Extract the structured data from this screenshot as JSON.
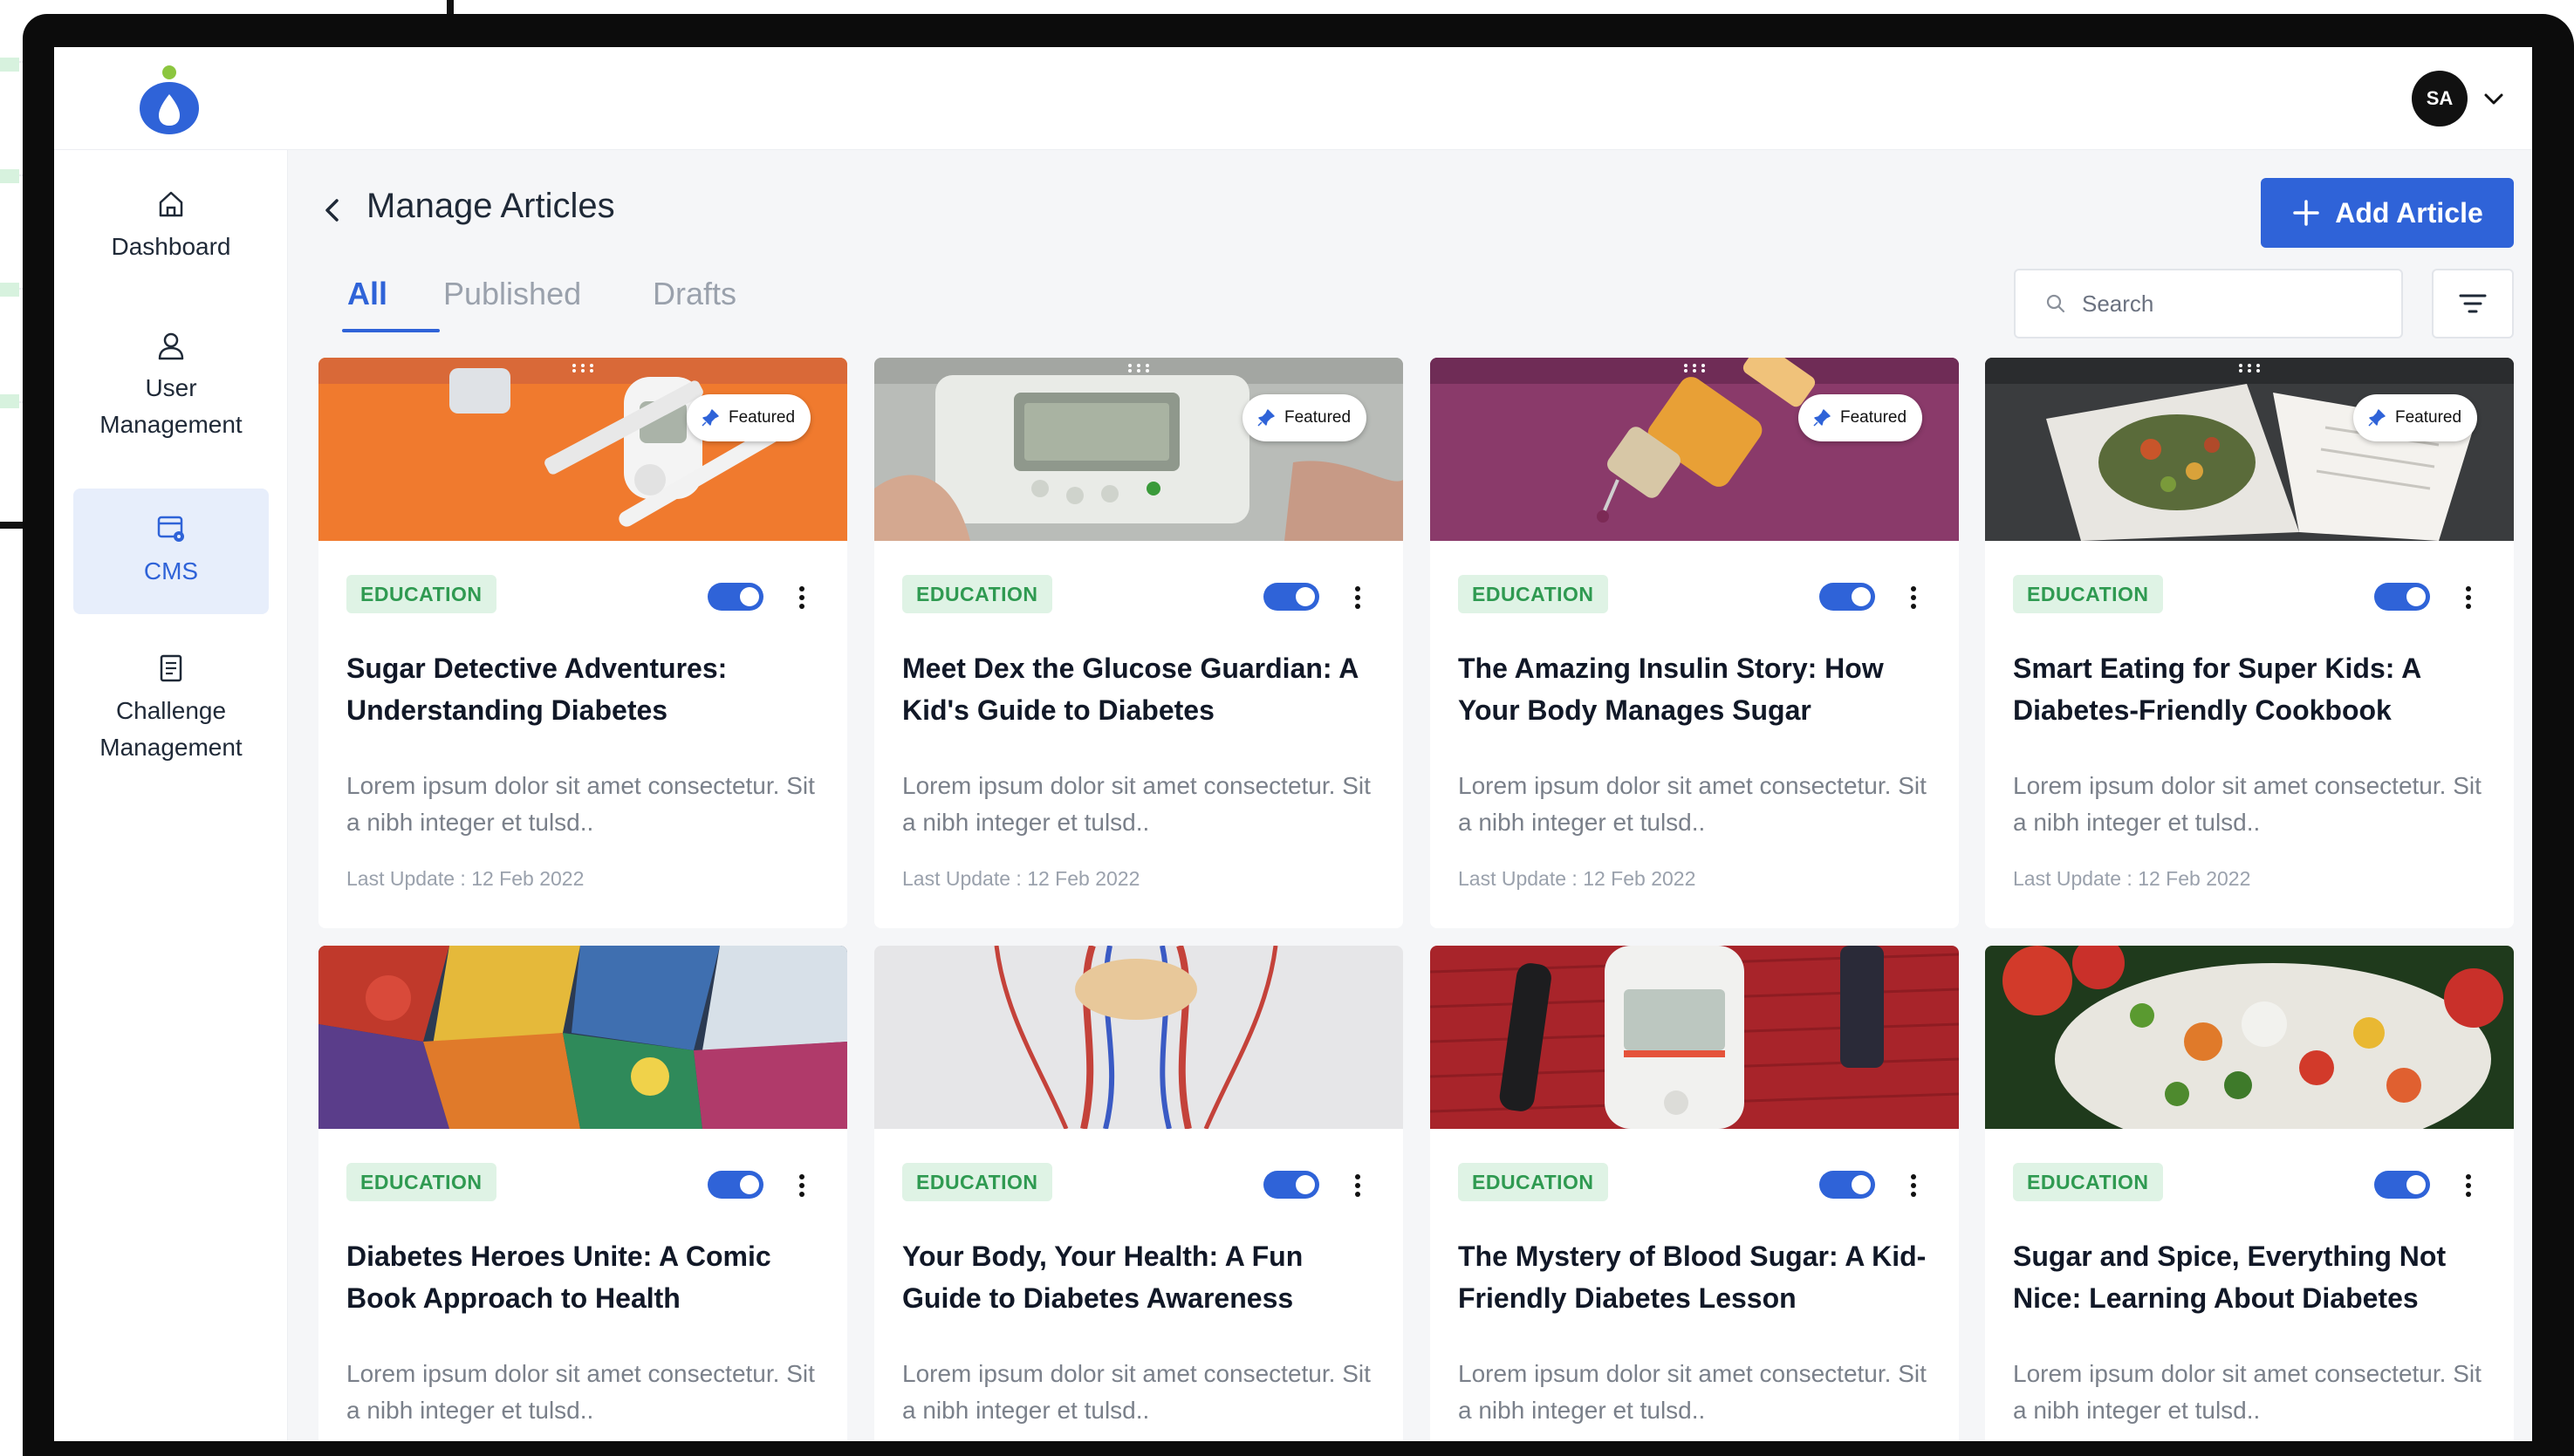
{
  "app": {
    "user_initials": "SA"
  },
  "sidebar": {
    "items": [
      {
        "label_line1": "Dashboard",
        "label_line2": "",
        "icon": "home-icon",
        "active": false
      },
      {
        "label_line1": "User",
        "label_line2": "Management",
        "icon": "user-icon",
        "active": false
      },
      {
        "label_line1": "CMS",
        "label_line2": "",
        "icon": "cms-icon",
        "active": true
      },
      {
        "label_line1": "Challenge",
        "label_line2": "Management",
        "icon": "clipboard-icon",
        "active": false
      }
    ]
  },
  "header": {
    "title": "Manage Articles",
    "add_button_label": "Add Article"
  },
  "tabs": [
    {
      "label": "All",
      "active": true
    },
    {
      "label": "Published",
      "active": false
    },
    {
      "label": "Drafts",
      "active": false
    }
  ],
  "search": {
    "placeholder": "Search"
  },
  "colors": {
    "accent": "#2f63d8",
    "tag_bg": "#dff3e5",
    "tag_text": "#2f9a51"
  },
  "articles": [
    {
      "title": "Sugar Detective Adventures: Understanding Diabetes",
      "category": "EDUCATION",
      "featured": "Featured",
      "description": "Lorem ipsum dolor sit amet consectetur. Sit a nibh integer et tulsd..",
      "last_update": "Last Update : 12 Feb 2022",
      "published": true
    },
    {
      "title": "Meet Dex the Glucose Guardian: A Kid's Guide to Diabetes",
      "category": "EDUCATION",
      "featured": "Featured",
      "description": "Lorem ipsum dolor sit amet consectetur. Sit a nibh integer et tulsd..",
      "last_update": "Last Update : 12 Feb 2022",
      "published": true
    },
    {
      "title": "The Amazing Insulin Story: How Your Body Manages Sugar",
      "category": "EDUCATION",
      "featured": "Featured",
      "description": "Lorem ipsum dolor sit amet consectetur. Sit a nibh integer et tulsd..",
      "last_update": "Last Update : 12 Feb 2022",
      "published": true
    },
    {
      "title": "Smart Eating for Super Kids: A Diabetes-Friendly Cookbook",
      "category": "EDUCATION",
      "featured": "Featured",
      "description": "Lorem ipsum dolor sit amet consectetur. Sit a nibh integer et tulsd..",
      "last_update": "Last Update : 12 Feb 2022",
      "published": true
    },
    {
      "title": "Diabetes Heroes Unite: A Comic Book Approach to Health",
      "category": "EDUCATION",
      "description": "Lorem ipsum dolor sit amet consectetur. Sit a nibh integer et tulsd..",
      "published": true
    },
    {
      "title": "Your Body, Your Health: A Fun Guide to Diabetes Awareness",
      "category": "EDUCATION",
      "description": "Lorem ipsum dolor sit amet consectetur. Sit a nibh integer et tulsd..",
      "published": true
    },
    {
      "title": "The Mystery of Blood Sugar: A Kid-Friendly Diabetes Lesson",
      "category": "EDUCATION",
      "description": "Lorem ipsum dolor sit amet consectetur. Sit a nibh integer et tulsd..",
      "published": true
    },
    {
      "title": "Sugar and Spice, Everything Not Nice: Learning About Diabetes",
      "category": "EDUCATION",
      "description": "Lorem ipsum dolor sit amet consectetur. Sit a nibh integer et tulsd..",
      "published": true
    }
  ]
}
